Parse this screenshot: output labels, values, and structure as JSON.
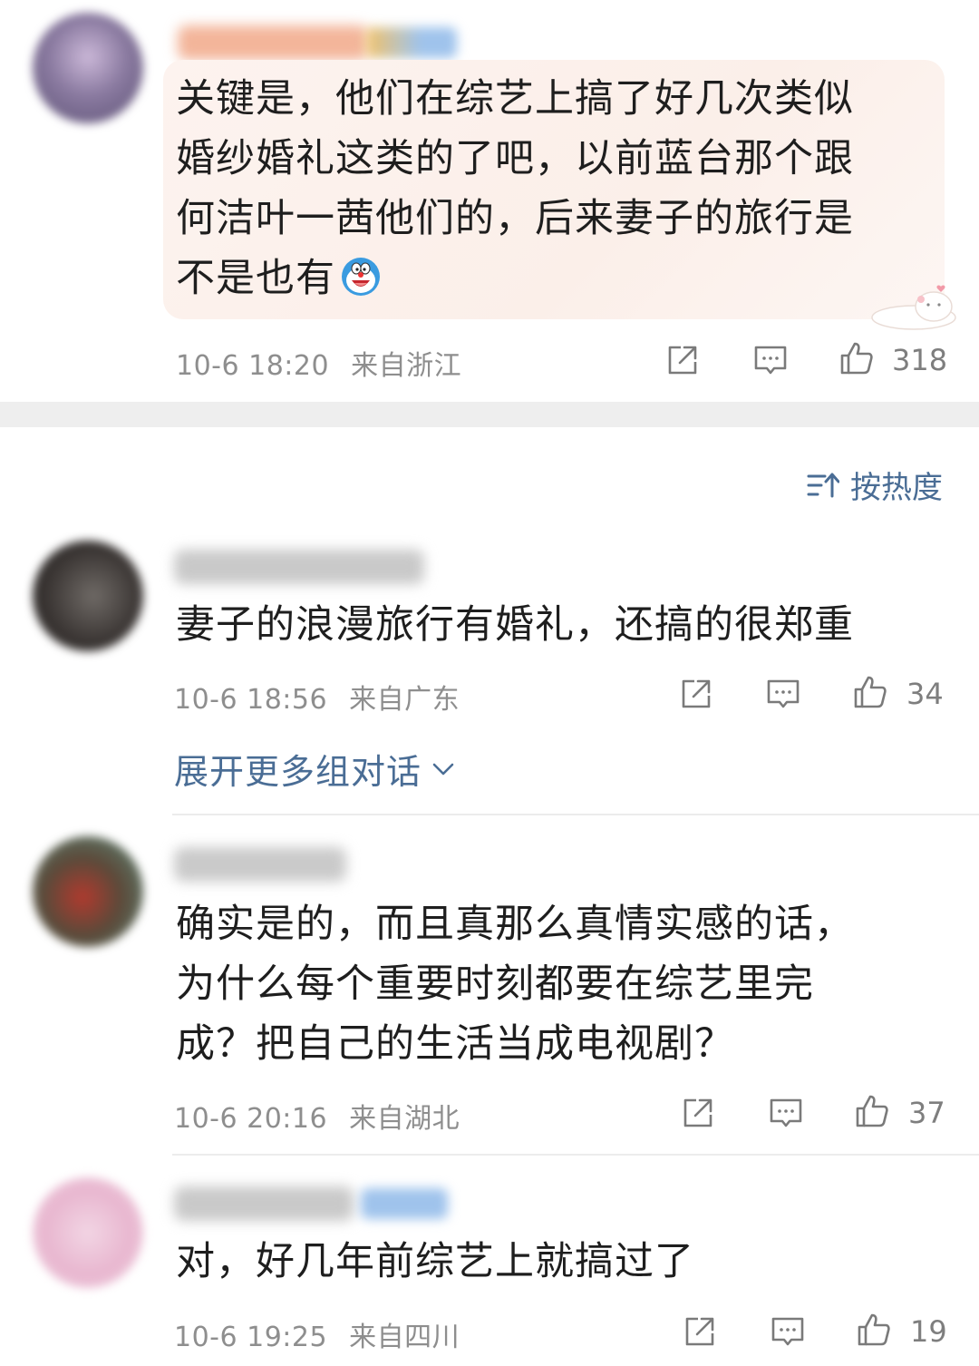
{
  "comments": [
    {
      "text_lines": [
        "关键是，他们在综艺上搞了好几次类似",
        "婚纱婚礼这类的了吧，以前蓝台那个跟",
        "何洁叶一茜他们的，后来妻子的旅行是",
        "不是也有"
      ],
      "time": "10-6 18:20",
      "location": "来自浙江",
      "likes": "318"
    },
    {
      "text_lines": [
        "妻子的浪漫旅行有婚礼，还搞的很郑重"
      ],
      "time": "10-6 18:56",
      "location": "来自广东",
      "likes": "34"
    },
    {
      "text_lines": [
        "确实是的，而且真那么真情实感的话，",
        "为什么每个重要时刻都要在综艺里完",
        "成？把自己的生活当成电视剧？"
      ],
      "time": "10-6 20:16",
      "location": "来自湖北",
      "likes": "37"
    },
    {
      "text_lines": [
        "对，好几年前综艺上就搞过了"
      ],
      "time": "10-6 19:25",
      "location": "来自四川",
      "likes": "19"
    }
  ],
  "sort_label": "按热度",
  "expand_label": "展开更多组对话",
  "icons": {
    "repost": "share-box-icon",
    "comment": "comment-icon",
    "like": "thumbs-up-icon",
    "sort": "sort-icon",
    "expand": "chevron-down-icon",
    "emoji": "doraemon-emoji-icon",
    "sticker": "cat-sticker-icon"
  },
  "colors": {
    "link": "#4a6d95",
    "meta": "#8e8e8e",
    "bubble": "#fcf1ec"
  }
}
